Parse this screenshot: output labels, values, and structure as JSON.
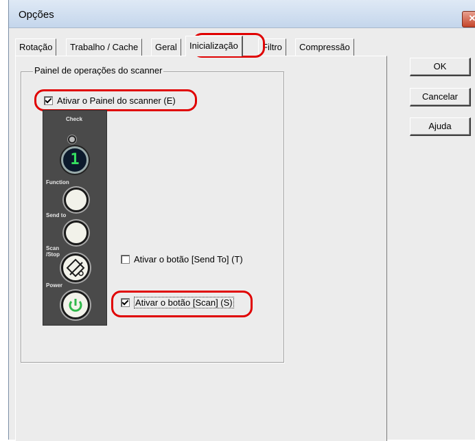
{
  "window": {
    "title": "Opções",
    "close_label": "✕"
  },
  "tabs": [
    {
      "label": "Rotação"
    },
    {
      "label": "Trabalho / Cache"
    },
    {
      "label": "Geral"
    },
    {
      "label": "Inicialização",
      "active": true
    },
    {
      "label": "Filtro"
    },
    {
      "label": "Compressão"
    }
  ],
  "buttons": {
    "ok": "OK",
    "cancel": "Cancelar",
    "help": "Ajuda"
  },
  "group": {
    "title": "Painel de operações do scanner"
  },
  "checkboxes": {
    "enable_panel": {
      "label": "Ativar o Painel do scanner (E)",
      "checked": true
    },
    "enable_send_to": {
      "label": "Ativar o botão [Send To] (T)",
      "checked": false
    },
    "enable_scan": {
      "label": "Ativar o botão [Scan] (S)",
      "checked": true
    }
  },
  "scanner_panel": {
    "check_label": "Check",
    "display_digit": "1",
    "function_label": "Function",
    "send_to_label": "Send to",
    "scan_stop_label": "Scan /Stop",
    "power_label": "Power"
  },
  "colors": {
    "highlight": "#e00000",
    "display_digit": "#35e060",
    "power_icon": "#2fb84a"
  }
}
